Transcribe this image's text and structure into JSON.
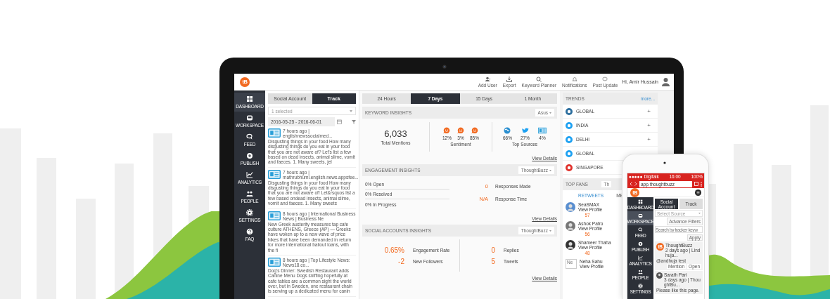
{
  "app": {
    "logo": "tB",
    "actions": [
      {
        "label": "Add User"
      },
      {
        "label": "Export"
      },
      {
        "label": "Keyword Planner"
      },
      {
        "label": "Notifications"
      },
      {
        "label": "Post Update"
      }
    ],
    "greeting": "Hi, Amir Hussain"
  },
  "sidebar": {
    "items": [
      {
        "label": "DASHBOARD",
        "selected": true
      },
      {
        "label": "WORKSPACE",
        "selected": false
      },
      {
        "label": "FEED",
        "selected": false
      },
      {
        "label": "PUBLISH",
        "selected": false
      },
      {
        "label": "ANALYTICS",
        "selected": false
      },
      {
        "label": "PEOPLE",
        "selected": false
      },
      {
        "label": "SETTINGS",
        "selected": false
      },
      {
        "label": "FAQ",
        "selected": false
      }
    ]
  },
  "feed": {
    "tabs": [
      {
        "label": "Social Account",
        "selected": false
      },
      {
        "label": "Track",
        "selected": true
      }
    ],
    "source_select": "1 selected",
    "date_range": "2016-05-25 - 2016-06-01",
    "posts": [
      {
        "meta": "7 hours ago | englishnewssocialmed...",
        "text": "Disgusting things in your food How many disgusting things do you eat in your food that you are not aware of? Let's list a few based on dead insects, animal slime, vomit and faeces. 1. Many sweets, jel"
      },
      {
        "meta": "7 hours ago | mathrubhumi.english.news.appsfee...",
        "text": "Disgusting things in your food How many disgusting things do you eat in your food that you are not aware of! Let&rsquos list a few based ondead insects, animal slime, vomit and faeces. 1. Many sweets"
      },
      {
        "meta": "8 hours ago | International Business News | Business Ne",
        "text": "New Greek austerity measures tap cafe culture ATHENS, Greece (AP) — Greeks have woken up to a new wave of price hikes that have been demanded in return for more international bailout loans, with the fi"
      },
      {
        "meta": "8 hours ago | Top Lifestyle News: News18.co...",
        "text": "Dog's Dinner: Swedish Restaurant adds Canine Menu Dogs sniffing hopefully at cafe tables are a common sight the world over, but in Sweden, one restaurant chain is serving up a dedicated menu for canin"
      }
    ]
  },
  "range_tabs": [
    {
      "label": "24 Hours",
      "selected": false
    },
    {
      "label": "7 Days",
      "selected": true
    },
    {
      "label": "15 Days",
      "selected": false
    },
    {
      "label": "1 Month",
      "selected": false
    }
  ],
  "keyword_insights": {
    "title": "KEYWORD INSIGHTS",
    "dropdown": "Asus",
    "total": "6,033",
    "total_label": "Total Mentions",
    "sentiment": [
      {
        "value": "12%"
      },
      {
        "value": "3%"
      },
      {
        "value": "85%"
      }
    ],
    "sentiment_label": "Sentiment",
    "sources": [
      {
        "value": "66%"
      },
      {
        "value": "27%"
      },
      {
        "value": "4%"
      }
    ],
    "sources_label": "Top Sources",
    "link": "View Details"
  },
  "engagement_insights": {
    "title": "ENGAGEMENT INSIGHTS",
    "dropdown": "ThoughtBuzz",
    "statuses": [
      "0% Open",
      "0% Resolved",
      "0% In Progress"
    ],
    "metrics": [
      {
        "value": "0",
        "label": "Responses Made"
      },
      {
        "value": "N/A",
        "label": "Response Time"
      }
    ],
    "link": "View Details"
  },
  "social_insights": {
    "title": "SOCIAL ACCOUNTS INSIGHTS",
    "dropdown": "ThoughtBuzz",
    "metrics": [
      {
        "value": "0.65%",
        "label": "Engagement Rate"
      },
      {
        "value": "-2",
        "label": "New Followers"
      },
      {
        "value": "0",
        "label": "Replies"
      },
      {
        "value": "5",
        "label": "Tweets"
      }
    ],
    "link": "View Details"
  },
  "trends": {
    "title": "TRENDS",
    "more": "more...",
    "items": [
      {
        "label": "GLOBAL",
        "color": "#2c6e9e",
        "action": "+"
      },
      {
        "label": "INDIA",
        "color": "#1da1f2",
        "action": "+"
      },
      {
        "label": "DELHI",
        "color": "#1da1f2",
        "action": "+"
      },
      {
        "label": "GLOBAL",
        "color": "#1da1f2"
      },
      {
        "label": "SINGAPORE",
        "color": "#e0302a"
      }
    ]
  },
  "top_fans": {
    "title": "TOP FANS",
    "dropdown": "Th",
    "tabs": [
      {
        "label": "RETWEETS",
        "selected": true
      },
      {
        "label": "ME",
        "selected": false
      }
    ],
    "fans": [
      {
        "name": "SeaSMAX",
        "link": "View Profile",
        "count": "57"
      },
      {
        "name": "Ashok Patro",
        "link": "View Profile",
        "count": "56"
      },
      {
        "name": "Shameer Thaha",
        "link": "View Profile",
        "count": "48"
      },
      {
        "name": "Neha Sahu",
        "link": "View Profile",
        "alt": "Ne"
      }
    ]
  },
  "phone": {
    "status": {
      "carrier": "●●●●● Digitalk",
      "time": "16:00",
      "battery": "100%"
    },
    "url": "app.thoughtbuzz",
    "logo": "tB",
    "sidebar": [
      {
        "label": "DASHBOARD",
        "selected": false
      },
      {
        "label": "WORKSPACE",
        "selected": true
      },
      {
        "label": "FEED",
        "selected": false
      },
      {
        "label": "PUBLISH",
        "selected": false
      },
      {
        "label": "ANALYTICS",
        "selected": false
      },
      {
        "label": "PEOPLE",
        "selected": false
      },
      {
        "label": "SETTINGS",
        "selected": false
      }
    ],
    "tabs": [
      {
        "label": "Social Account",
        "selected": true
      },
      {
        "label": "Track",
        "selected": false
      }
    ],
    "source_select": "Select Source",
    "filters": "Advance Filters",
    "search_placeholder": "Search by tracker keyw",
    "apply": "Apply",
    "posts": [
      {
        "avatar": "tB",
        "author": "ThoughtBuzz",
        "meta": "2 days ago | Lindhuja...",
        "text": "@andhuja test",
        "actions": [
          "Mention",
          "Open"
        ]
      },
      {
        "author": "Sarath Pari",
        "meta": "3 days ago | ThoughtBu...",
        "text": "Please like this page."
      }
    ]
  }
}
